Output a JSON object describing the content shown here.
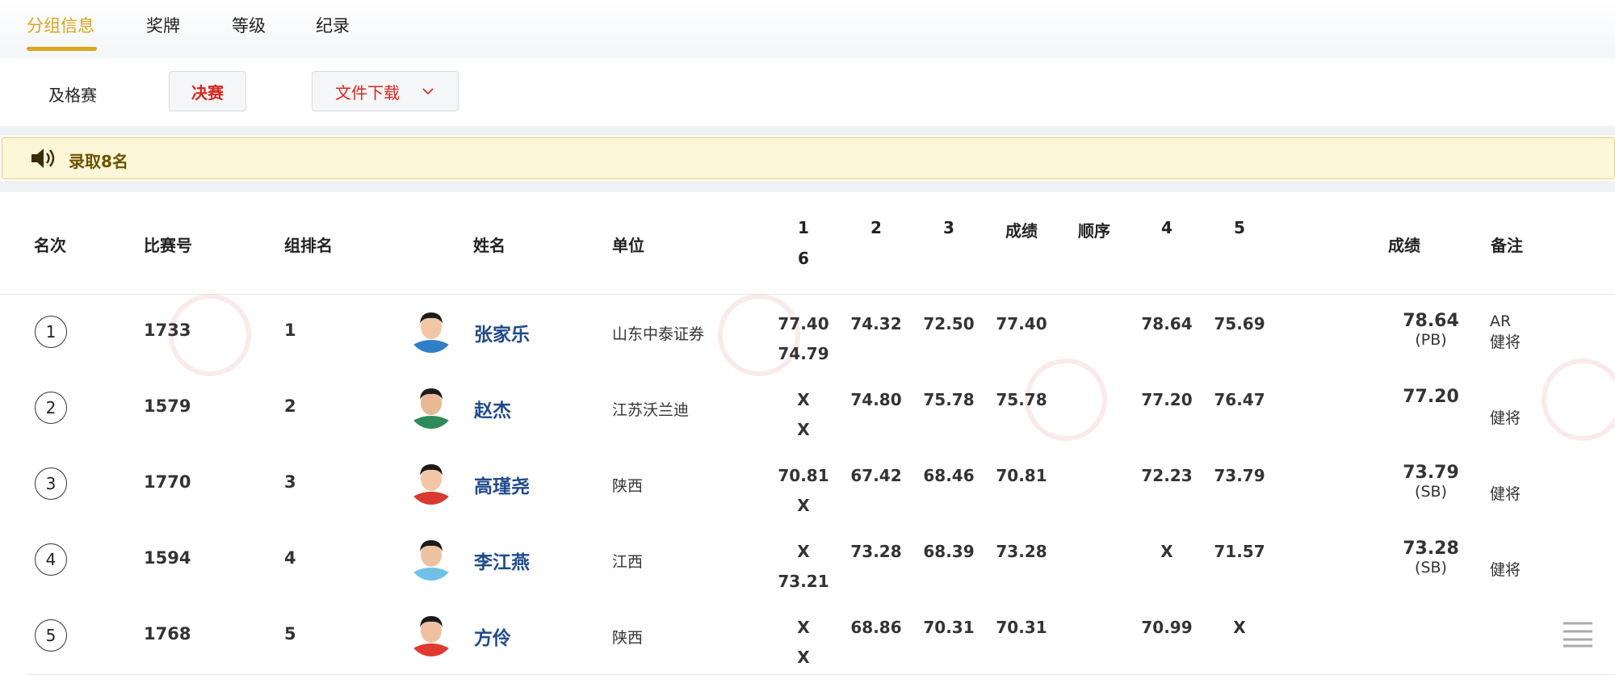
{
  "tabs": [
    "分组信息",
    "奖牌",
    "等级",
    "纪录"
  ],
  "rounds": {
    "qualify": "及格赛",
    "final": "决赛",
    "download": "文件下载"
  },
  "notice": "录取8名",
  "headers": {
    "rank": "名次",
    "bib": "比赛号",
    "group_rank": "组排名",
    "name": "姓名",
    "unit": "单位",
    "a1": "1",
    "a6": "6",
    "a2": "2",
    "a3": "3",
    "score_mid": "成绩",
    "order": "顺序",
    "a4": "4",
    "a5": "5",
    "score": "成绩",
    "remark": "备注"
  },
  "rows": [
    {
      "rank": "1",
      "bib": "1733",
      "group_rank": "1",
      "name": "张家乐",
      "unit": "山东中泰证券",
      "a1": "77.40",
      "a6": "74.79",
      "a2": "74.32",
      "a3": "72.50",
      "score_mid": "77.40",
      "a4": "78.64",
      "a5": "75.69",
      "score": "78.64",
      "score_note": "(PB)",
      "remark1": "AR",
      "remark2": "健将",
      "shirt": "#2f7fc9",
      "skin": "#f1c7a3"
    },
    {
      "rank": "2",
      "bib": "1579",
      "group_rank": "2",
      "name": "赵杰",
      "unit": "江苏沃兰迪",
      "a1": "X",
      "a6": "X",
      "a2": "74.80",
      "a3": "75.78",
      "score_mid": "75.78",
      "a4": "77.20",
      "a5": "76.47",
      "score": "77.20",
      "score_note": "",
      "remark1": "",
      "remark2": "健将",
      "shirt": "#2e8b57",
      "skin": "#e9b894"
    },
    {
      "rank": "3",
      "bib": "1770",
      "group_rank": "3",
      "name": "高瑾尧",
      "unit": "陕西",
      "a1": "70.81",
      "a6": "X",
      "a2": "67.42",
      "a3": "68.46",
      "score_mid": "70.81",
      "a4": "72.23",
      "a5": "73.79",
      "score": "73.79",
      "score_note": "(SB)",
      "remark1": "",
      "remark2": "健将",
      "shirt": "#d9392e",
      "skin": "#f3c6a6"
    },
    {
      "rank": "4",
      "bib": "1594",
      "group_rank": "4",
      "name": "李江燕",
      "unit": "江西",
      "a1": "X",
      "a6": "73.21",
      "a2": "73.28",
      "a3": "68.39",
      "score_mid": "73.28",
      "a4": "X",
      "a5": "71.57",
      "score": "73.28",
      "score_note": "(SB)",
      "remark1": "",
      "remark2": "健将",
      "shirt": "#6fc1e8",
      "skin": "#edc2a0"
    },
    {
      "rank": "5",
      "bib": "1768",
      "group_rank": "5",
      "name": "方伶",
      "unit": "陕西",
      "a1": "X",
      "a6": "X",
      "a2": "68.86",
      "a3": "70.31",
      "score_mid": "70.31",
      "a4": "70.99",
      "a5": "X",
      "score": "",
      "score_note": "",
      "remark1": "",
      "remark2": "",
      "shirt": "#e0392f",
      "skin": "#f0c19e"
    }
  ]
}
